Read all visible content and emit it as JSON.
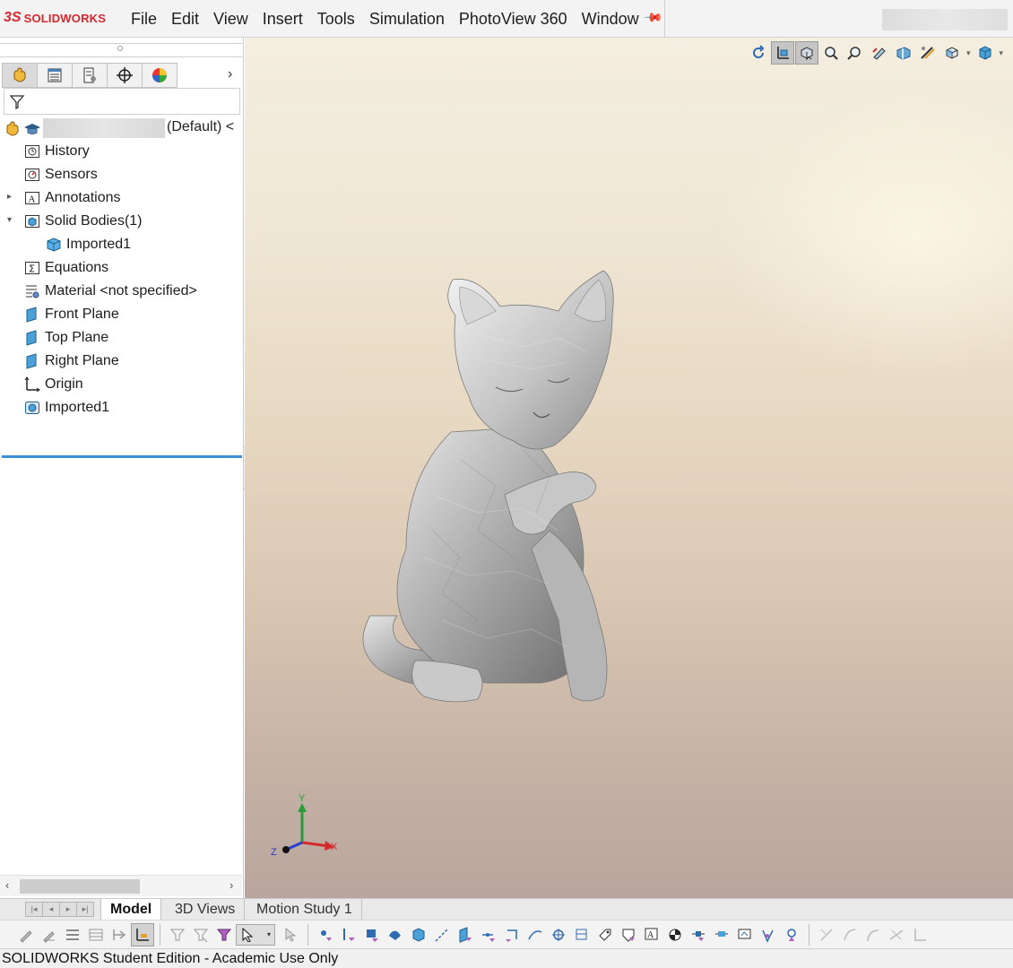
{
  "app": {
    "logo_mark": "3S",
    "logo_text": "SOLIDWORKS",
    "menu": [
      "File",
      "Edit",
      "View",
      "Insert",
      "Tools",
      "Simulation",
      "PhotoView 360",
      "Window"
    ]
  },
  "feature_manager": {
    "tabs": [
      "feature-manager",
      "property-manager",
      "configuration-manager",
      "dimxpert-manager",
      "display-manager"
    ],
    "root_suffix": "(Default) <",
    "items": [
      {
        "label": "History",
        "icon": "history-icon",
        "expander": ""
      },
      {
        "label": "Sensors",
        "icon": "sensors-icon",
        "expander": ""
      },
      {
        "label": "Annotations",
        "icon": "annotations-icon",
        "expander": "▸"
      },
      {
        "label": "Solid Bodies(1)",
        "icon": "solid-bodies-icon",
        "expander": "▾"
      },
      {
        "label": "Imported1",
        "icon": "body-icon",
        "expander": ""
      },
      {
        "label": "Equations",
        "icon": "equations-icon",
        "expander": ""
      },
      {
        "label": "Material <not specified>",
        "icon": "material-icon",
        "expander": ""
      },
      {
        "label": "Front Plane",
        "icon": "plane-icon",
        "expander": ""
      },
      {
        "label": "Top Plane",
        "icon": "plane-icon",
        "expander": ""
      },
      {
        "label": "Right Plane",
        "icon": "plane-icon",
        "expander": ""
      },
      {
        "label": "Origin",
        "icon": "origin-icon",
        "expander": ""
      },
      {
        "label": "Imported1",
        "icon": "imported-feature-icon",
        "expander": ""
      }
    ]
  },
  "viewport": {
    "triad": {
      "x": "X",
      "y": "Y",
      "z": "Z"
    }
  },
  "bottom_tabs": [
    "Model",
    "3D Views",
    "Motion Study 1"
  ],
  "status": "SOLIDWORKS Student Edition - Academic Use Only",
  "colors": {
    "brand": "#d9262c",
    "selection_underline": "#3c8fd8"
  }
}
